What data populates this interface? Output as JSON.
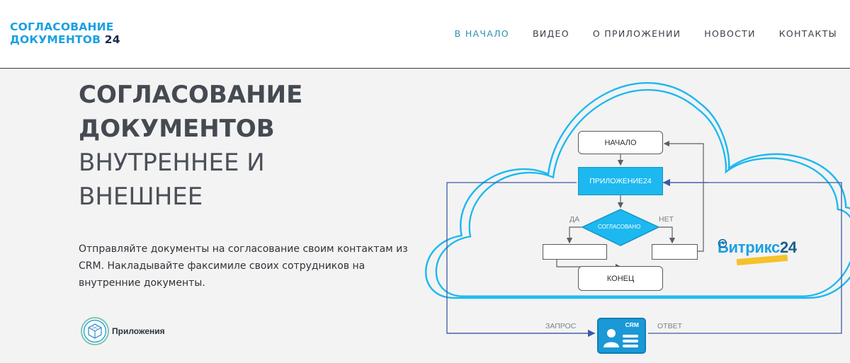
{
  "header": {
    "logo_line1": "СОГЛАСОВАНИЕ",
    "logo_line2": "ДОКУМЕНТОВ",
    "logo_num": "24",
    "nav": [
      {
        "label": "В НАЧАЛО",
        "active": true
      },
      {
        "label": "ВИДЕО"
      },
      {
        "label": "О ПРИЛОЖЕНИИ"
      },
      {
        "label": "НОВОСТИ"
      },
      {
        "label": "КОНТАКТЫ"
      }
    ]
  },
  "hero": {
    "title_bold_1": "СОГЛАСОВАНИЕ",
    "title_bold_2": "ДОКУМЕНТОВ",
    "title_light_1": "ВНУТРЕННЕЕ И",
    "title_light_2": "ВНЕШНЕЕ",
    "description": "Отправляйте документы на согласование своим контактам из CRM. Накладывайте факсимиле своих сотрудников на внутренние документы.",
    "apps_badge": "Приложения"
  },
  "diagram": {
    "start": "НАЧАЛО",
    "app": "ПРИЛОЖЕНИЕ24",
    "decision": "СОГЛАСОВАНО",
    "yes": "ДА",
    "no": "НЕТ",
    "end": "КОНЕЦ",
    "request": "ЗАПРОС",
    "response": "ОТВЕТ",
    "crm": "CRM",
    "bitrix_text": "Битрикс",
    "bitrix_num": "24"
  },
  "colors": {
    "accent": "#1aa0e4",
    "cloud": "#1db8ef",
    "line": "#3d5aa8"
  }
}
